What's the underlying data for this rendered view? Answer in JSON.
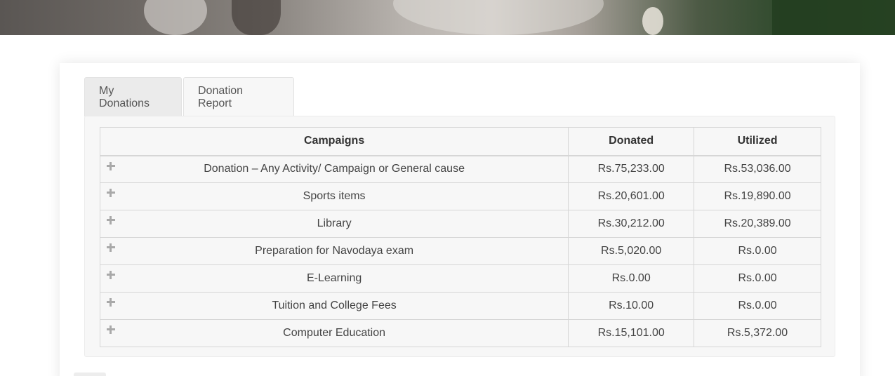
{
  "tabs": [
    {
      "label": "My Donations"
    },
    {
      "label": "Donation Report"
    }
  ],
  "table": {
    "headers": {
      "campaigns": "Campaigns",
      "donated": "Donated",
      "utilized": "Utilized"
    },
    "rows": [
      {
        "campaign": "Donation – Any Activity/ Campaign or General cause",
        "donated": "Rs.75,233.00",
        "utilized": "Rs.53,036.00"
      },
      {
        "campaign": "Sports items",
        "donated": "Rs.20,601.00",
        "utilized": "Rs.19,890.00"
      },
      {
        "campaign": "Library",
        "donated": "Rs.30,212.00",
        "utilized": "Rs.20,389.00"
      },
      {
        "campaign": "Preparation for Navodaya exam",
        "donated": "Rs.5,020.00",
        "utilized": "Rs.0.00"
      },
      {
        "campaign": "E-Learning",
        "donated": "Rs.0.00",
        "utilized": "Rs.0.00"
      },
      {
        "campaign": "Tuition and College Fees",
        "donated": "Rs.10.00",
        "utilized": "Rs.0.00"
      },
      {
        "campaign": "Computer Education",
        "donated": "Rs.15,101.00",
        "utilized": "Rs.5,372.00"
      }
    ]
  },
  "icons": {
    "expand": "plus-icon"
  }
}
